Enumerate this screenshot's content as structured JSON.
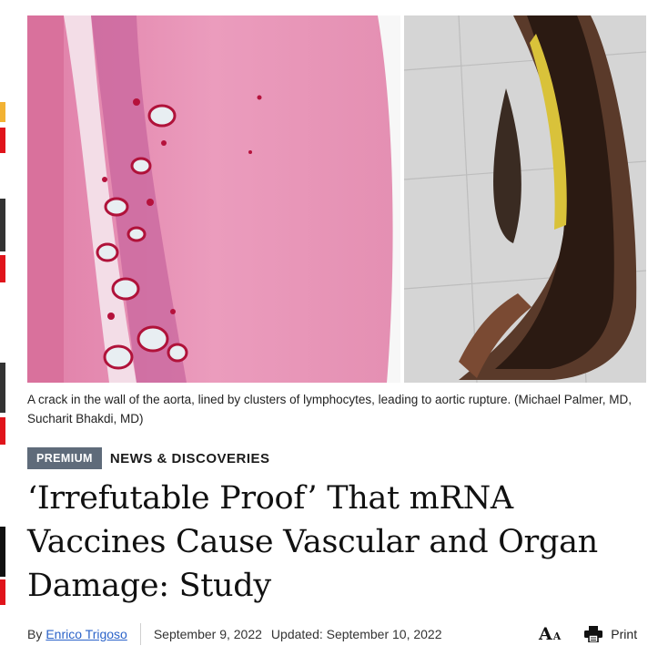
{
  "article": {
    "image": {
      "caption": "A crack in the wall of the aorta, lined by clusters of lymphocytes, leading to aortic rupture. (Michael Palmer, MD, Sucharit Bhakdi, MD)"
    },
    "premium_badge": "PREMIUM",
    "section_label": "NEWS & DISCOVERIES",
    "headline": "‘Irrefutable Proof’ That mRNA Vaccines Cause Vascular and Organ Damage: Study",
    "byline": {
      "prefix": "By",
      "author": "Enrico Trigoso",
      "published": "September 9, 2022",
      "updated": "Updated: September 10, 2022"
    },
    "tools": {
      "font_size_big": "A",
      "font_size_small": "A",
      "print_label": "Print"
    }
  },
  "colors": {
    "premium_bg": "#5f6b7a",
    "author_link": "#2b63c9",
    "side_red": "#e0141b",
    "side_yellow": "#f2b233",
    "side_dark": "#333333"
  },
  "icons": [
    "printer-icon",
    "font-size-icon"
  ]
}
